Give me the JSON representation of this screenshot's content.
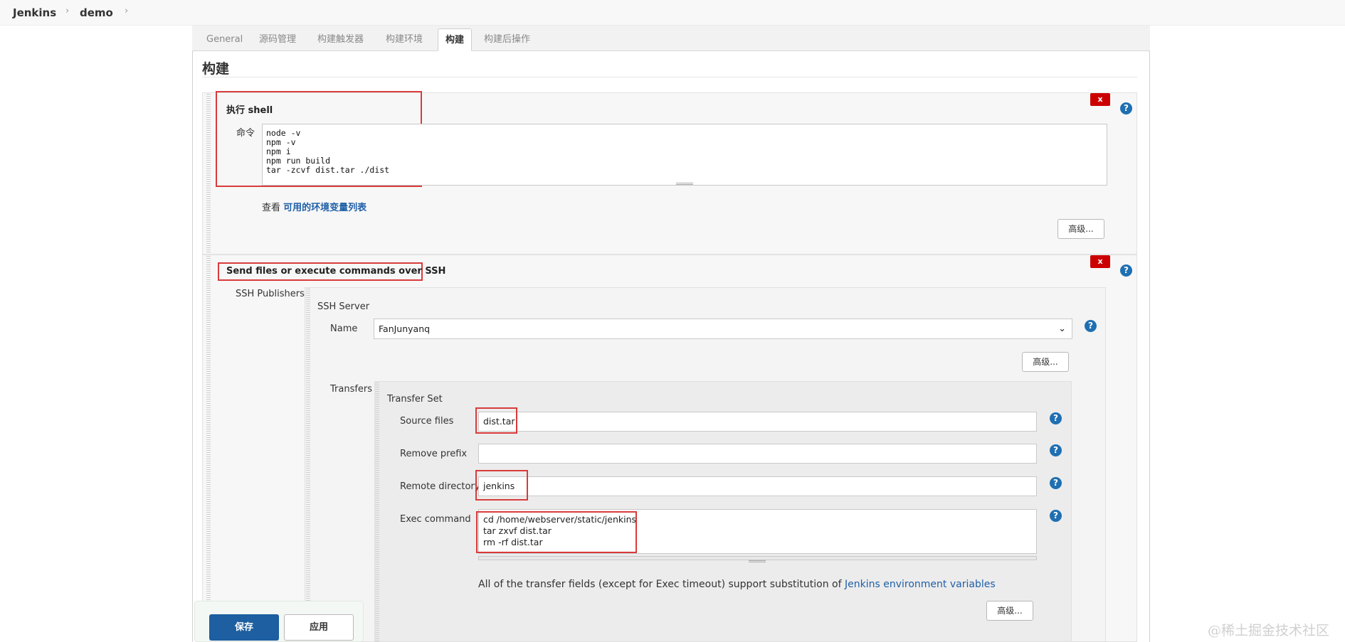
{
  "breadcrumb": {
    "root": "Jenkins",
    "project": "demo",
    "sep": "›"
  },
  "tabs": [
    {
      "label": "General"
    },
    {
      "label": "源码管理"
    },
    {
      "label": "构建触发器"
    },
    {
      "label": "构建环境"
    },
    {
      "label": "构建"
    },
    {
      "label": "构建后操作"
    }
  ],
  "section_title": "构建",
  "shell_step": {
    "title": "执行 shell",
    "command_label": "命令",
    "command_lines": "node -v\nnpm -v\nnpm i\nnpm run build\ntar -zcvf dist.tar ./dist",
    "env_prefix": "查看",
    "env_link": "可用的环境变量列表",
    "advanced": "高级...",
    "delete": "x",
    "help": "?"
  },
  "ssh_step": {
    "title": "Send files or execute commands over SSH",
    "publishers_label": "SSH Publishers",
    "server_label": "SSH Server",
    "name_label": "Name",
    "name_value": "FanJunyanq",
    "advanced": "高级...",
    "transfers_label": "Transfers",
    "transfer_set_label": "Transfer Set",
    "source_files_label": "Source files",
    "source_files_value": "dist.tar",
    "remove_prefix_label": "Remove prefix",
    "remove_prefix_value": "",
    "remote_dir_label": "Remote directory",
    "remote_dir_value": "jenkins",
    "exec_command_label": "Exec command",
    "exec_command_value": "cd /home/webserver/static/jenkins\ntar zxvf dist.tar\nrm -rf dist.tar",
    "note_text": "All of the transfer fields (except for Exec timeout) support substitution of",
    "note_link": "Jenkins environment variables",
    "transfer_advanced": "高级...",
    "delete": "x",
    "help": "?"
  },
  "buttons": {
    "save": "保存",
    "apply": "应用"
  },
  "watermark": "@稀土掘金技术社区",
  "colors": {
    "highlight": "#d93b3b",
    "primary": "#1d5fa0",
    "link": "#1f5fa8",
    "delete": "#cc0000"
  }
}
